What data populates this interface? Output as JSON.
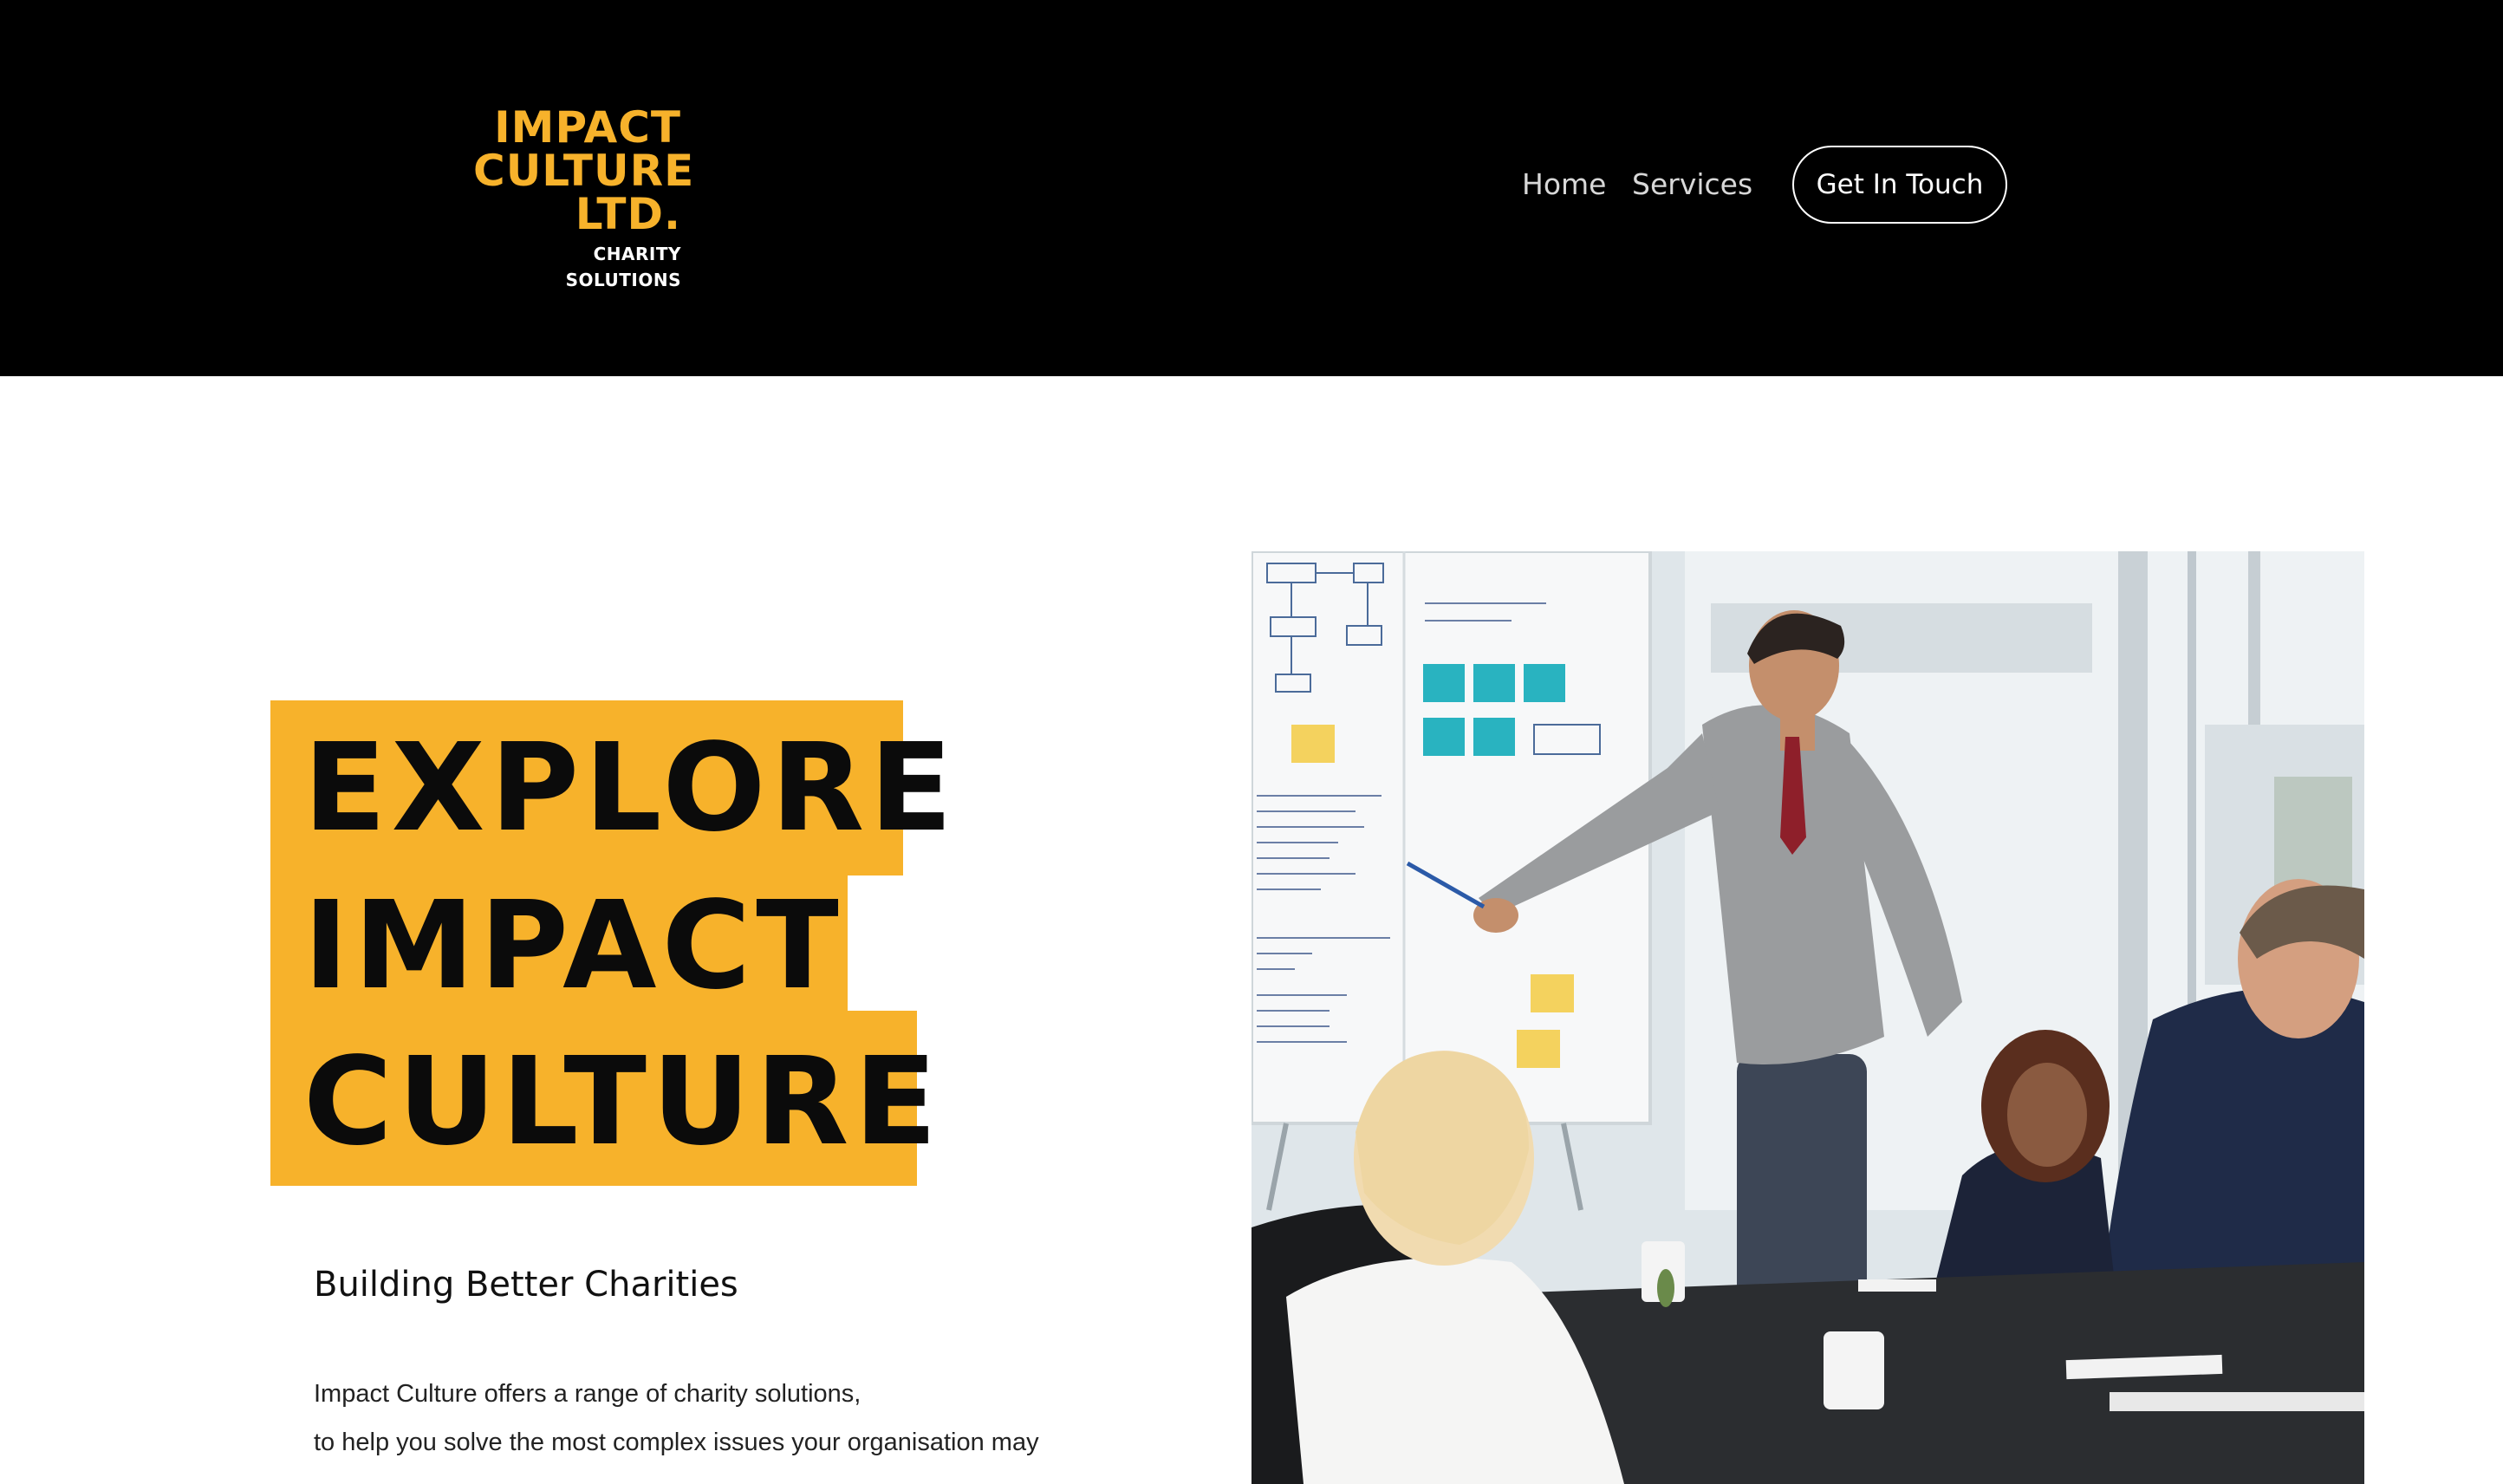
{
  "header": {
    "logo": {
      "line1": "IMPACT",
      "line2": "CULTURE",
      "line3": "LTD.",
      "tagline": "CHARITY SOLUTIONS"
    },
    "nav": {
      "home": "Home",
      "services": "Services"
    },
    "cta_label": "Get In Touch"
  },
  "hero": {
    "headline": [
      "EXPLORE",
      "IMPACT",
      "CULTURE"
    ],
    "subtitle": "Building Better Charities",
    "body_lines": [
      "Impact Culture offers a range of charity solutions,",
      "to help you solve the most complex issues your organisation may"
    ]
  },
  "colors": {
    "accent": "#f7b22b",
    "header_bg": "#000000",
    "page_bg": "#ffffff"
  }
}
